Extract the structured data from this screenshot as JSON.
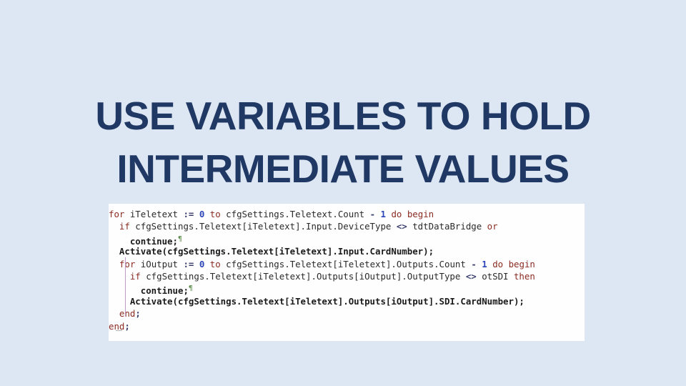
{
  "slide": {
    "background_color": "#dde6f3",
    "title": {
      "color": "#1f3864",
      "line1": "USE VARIABLES TO HOLD",
      "line2": "INTERMEDIATE VALUES"
    },
    "code_image": {
      "background_color": "#fefefe",
      "language": "Pascal",
      "keyword_color": "#8b2b22",
      "number_color": "#2b45b8",
      "operator_color": "#3a3f6d",
      "indent_guide_color": "#c39ac9",
      "paragraph_mark": "¶",
      "lines": [
        {
          "indent": 0,
          "tokens": [
            {
              "t": "for",
              "c": "kw"
            },
            {
              "t": " iTeletext ",
              "c": "id"
            },
            {
              "t": ":=",
              "c": "op"
            },
            {
              "t": " ",
              "c": "id"
            },
            {
              "t": "0",
              "c": "num"
            },
            {
              "t": " ",
              "c": "id"
            },
            {
              "t": "to",
              "c": "kw"
            },
            {
              "t": " cfgSettings.Teletext.Count ",
              "c": "id"
            },
            {
              "t": "-",
              "c": "op"
            },
            {
              "t": " ",
              "c": "id"
            },
            {
              "t": "1",
              "c": "num"
            },
            {
              "t": " ",
              "c": "id"
            },
            {
              "t": "do begin",
              "c": "kw"
            }
          ]
        },
        {
          "indent": 1,
          "tokens": [
            {
              "t": "if",
              "c": "kw"
            },
            {
              "t": " cfgSettings.Teletext[iTeletext].Input.DeviceType ",
              "c": "id"
            },
            {
              "t": "<>",
              "c": "op"
            },
            {
              "t": " tdtDataBridge ",
              "c": "id"
            },
            {
              "t": "or",
              "c": "kw"
            }
          ]
        },
        {
          "indent": 2,
          "tokens": [
            {
              "t": "continue;",
              "c": "bold"
            },
            {
              "t": "¶",
              "c": "mark"
            }
          ]
        },
        {
          "indent": 1,
          "tokens": [
            {
              "t": "Activate(",
              "c": "bold"
            },
            {
              "t": "cfgSettings.Teletext[iTeletext].Input.CardNumber",
              "c": "bold"
            },
            {
              "t": ");",
              "c": "bold"
            }
          ]
        },
        {
          "indent": 1,
          "tokens": [
            {
              "t": "for",
              "c": "kw"
            },
            {
              "t": " iOutput ",
              "c": "id"
            },
            {
              "t": ":=",
              "c": "op"
            },
            {
              "t": " ",
              "c": "id"
            },
            {
              "t": "0",
              "c": "num"
            },
            {
              "t": " ",
              "c": "id"
            },
            {
              "t": "to",
              "c": "kw"
            },
            {
              "t": " cfgSettings.Teletext[iTeletext].Outputs.Count ",
              "c": "id"
            },
            {
              "t": "-",
              "c": "op"
            },
            {
              "t": " ",
              "c": "id"
            },
            {
              "t": "1",
              "c": "num"
            },
            {
              "t": " ",
              "c": "id"
            },
            {
              "t": "do begin",
              "c": "kw"
            }
          ]
        },
        {
          "indent": 2,
          "tokens": [
            {
              "t": "if",
              "c": "kw"
            },
            {
              "t": " cfgSettings.Teletext[iTeletext].Outputs[iOutput].OutputType ",
              "c": "id"
            },
            {
              "t": "<>",
              "c": "op"
            },
            {
              "t": " otSDI ",
              "c": "id"
            },
            {
              "t": "then",
              "c": "kw"
            }
          ]
        },
        {
          "indent": 3,
          "tokens": [
            {
              "t": "continue;",
              "c": "bold"
            },
            {
              "t": "¶",
              "c": "mark"
            }
          ]
        },
        {
          "indent": 2,
          "tokens": [
            {
              "t": "Activate(",
              "c": "bold"
            },
            {
              "t": "cfgSettings.Teletext[iTeletext].Outputs[iOutput].SDI.CardNumber",
              "c": "bold"
            },
            {
              "t": ");",
              "c": "bold"
            }
          ]
        },
        {
          "indent": 1,
          "tokens": [
            {
              "t": "end",
              "c": "kw"
            },
            {
              "t": ";",
              "c": "op"
            }
          ]
        },
        {
          "indent": 0,
          "tokens": [
            {
              "t": "end",
              "c": "kw"
            },
            {
              "t": ";",
              "c": "op"
            }
          ]
        }
      ]
    }
  }
}
